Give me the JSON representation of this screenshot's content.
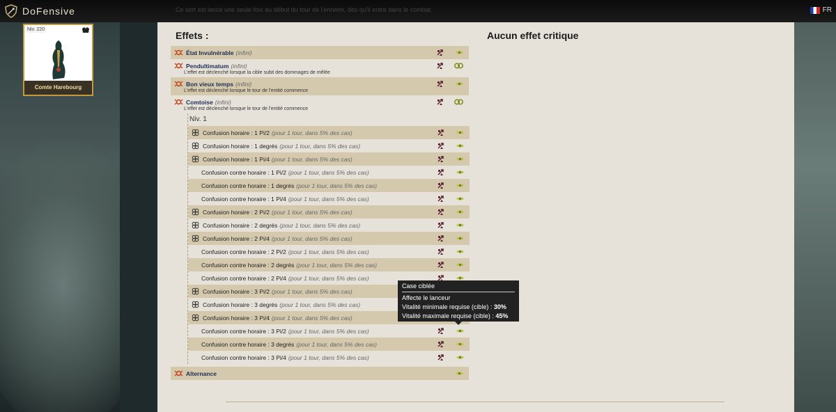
{
  "app": {
    "name": "DoFensive",
    "lang": "FR"
  },
  "top_note": "Ce sort est lancé une seule fois au début du tour de l'ennemi, dès qu'il entre dans le combat.",
  "monster": {
    "level": "Niv. 220",
    "name": "Comte Harebourg"
  },
  "headers": {
    "effects": "Effets :",
    "critical": "Aucun effet critique"
  },
  "effects": [
    {
      "name": "État Invulnérable",
      "duration": "(infini)",
      "desc": "",
      "eye": "small"
    },
    {
      "name": "Pendultimatum",
      "duration": "(infini)",
      "desc": "L'effet est déclenché lorsque la cible subit des dommages de mêlée",
      "eye": "big"
    },
    {
      "name": "Bon vieux temps",
      "duration": "(infini)",
      "desc": "L'effet est déclenché lorsque le tour de l'entité commence",
      "eye": "small"
    },
    {
      "name": "Comtoise",
      "duration": "(infini)",
      "desc": "L'effet est déclenché lorsque le tour de l'entité commence",
      "eye": "big"
    }
  ],
  "sub_level": "Niv. 1",
  "sub_effects": [
    {
      "name": "Confusion horaire : 1 Pi/2",
      "note": "(pour 1 tour, dans 5% des cas)",
      "icon": true
    },
    {
      "name": "Confusion horaire : 1 degrés",
      "note": "(pour 1 tour, dans 5% des cas)",
      "icon": true
    },
    {
      "name": "Confusion horaire : 1 Pi/4",
      "note": "(pour 1 tour, dans 5% des cas)",
      "icon": true
    },
    {
      "name": "Confusion contre horaire : 1 Pi/2",
      "note": "(pour 1 tour, dans 5% des cas)",
      "icon": false
    },
    {
      "name": "Confusion contre horaire : 1 degrés",
      "note": "(pour 1 tour, dans 5% des cas)",
      "icon": false
    },
    {
      "name": "Confusion contre horaire : 1 Pi/4",
      "note": "(pour 1 tour, dans 5% des cas)",
      "icon": false
    },
    {
      "name": "Confusion horaire : 2 Pi/2",
      "note": "(pour 1 tour, dans 5% des cas)",
      "icon": true
    },
    {
      "name": "Confusion horaire : 2 degrés",
      "note": "(pour 1 tour, dans 5% des cas)",
      "icon": true
    },
    {
      "name": "Confusion horaire : 2 Pi/4",
      "note": "(pour 1 tour, dans 5% des cas)",
      "icon": true
    },
    {
      "name": "Confusion contre horaire : 2 Pi/2",
      "note": "(pour 1 tour, dans 5% des cas)",
      "icon": false
    },
    {
      "name": "Confusion contre horaire : 2 degrés",
      "note": "(pour 1 tour, dans 5% des cas)",
      "icon": false
    },
    {
      "name": "Confusion contre horaire : 2 Pi/4",
      "note": "(pour 1 tour, dans 5% des cas)",
      "icon": false
    },
    {
      "name": "Confusion horaire : 3 Pi/2",
      "note": "(pour 1 tour, dans 5% des cas)",
      "icon": true
    },
    {
      "name": "Confusion horaire : 3 degrés",
      "note": "(pour 1 tour, dans 5% des cas)",
      "icon": true
    },
    {
      "name": "Confusion horaire : 3 Pi/4",
      "note": "(pour 1 tour, dans 5% des cas)",
      "icon": true
    },
    {
      "name": "Confusion contre horaire : 3 Pi/2",
      "note": "(pour 1 tour, dans 5% des cas)",
      "icon": false
    },
    {
      "name": "Confusion contre horaire : 3 degrés",
      "note": "(pour 1 tour, dans 5% des cas)",
      "icon": false
    },
    {
      "name": "Confusion contre horaire : 3 Pi/4",
      "note": "(pour 1 tour, dans 5% des cas)",
      "icon": false
    }
  ],
  "last_effect": {
    "name": "Alternance"
  },
  "tooltip": {
    "title": "Case ciblée",
    "line1": "Affecte le lanceur",
    "line2_label": "Vitalité minimale requise (cible) :",
    "line2_value": "30%",
    "line3_label": "Vitalité maximale requise (cible) :",
    "line3_value": "45%"
  },
  "colors": {
    "highlight": "#d4c8ad",
    "panel": "#e6e2da",
    "accent": "#c39a40",
    "link": "#1f2d55"
  }
}
